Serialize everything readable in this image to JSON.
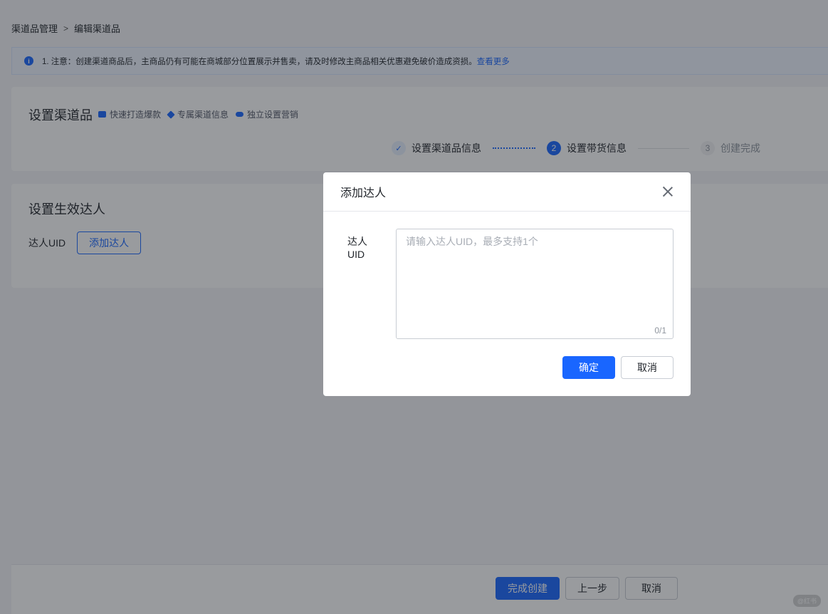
{
  "breadcrumb": {
    "parent": "渠道品管理",
    "separator": ">",
    "current": "编辑渠道品"
  },
  "notice": {
    "text": "1. 注意：创建渠道商品后，主商品仍有可能在商城部分位置展示并售卖，请及时修改主商品相关优惠避免破价造成资损。",
    "link": "查看更多",
    "icon": "info-icon"
  },
  "section1": {
    "title": "设置渠道品",
    "tags": [
      {
        "label": "快速打造爆款",
        "icon": "trend-icon"
      },
      {
        "label": "专属渠道信息",
        "icon": "diamond-icon"
      },
      {
        "label": "独立设置营销",
        "icon": "coupon-icon"
      }
    ],
    "steps": [
      {
        "number": "✓",
        "label": "设置渠道品信息",
        "status": "done"
      },
      {
        "number": "2",
        "label": "设置带货信息",
        "status": "active"
      },
      {
        "number": "3",
        "label": "创建完成",
        "status": "pending"
      }
    ]
  },
  "section2": {
    "title": "设置生效达人",
    "uid_label": "达人UID",
    "add_button": "添加达人"
  },
  "footer": {
    "finish": "完成创建",
    "prev": "上一步",
    "cancel": "取消"
  },
  "modal": {
    "title": "添加达人",
    "field_label": "达人UID",
    "placeholder": "请输入达人UID，最多支持1个",
    "value": "",
    "counter": "0/1",
    "confirm": "确定",
    "cancel": "取消"
  },
  "watermark": "@红书",
  "colors": {
    "primary": "#1966ff",
    "mask": "rgba(29,33,41,0.45)"
  }
}
